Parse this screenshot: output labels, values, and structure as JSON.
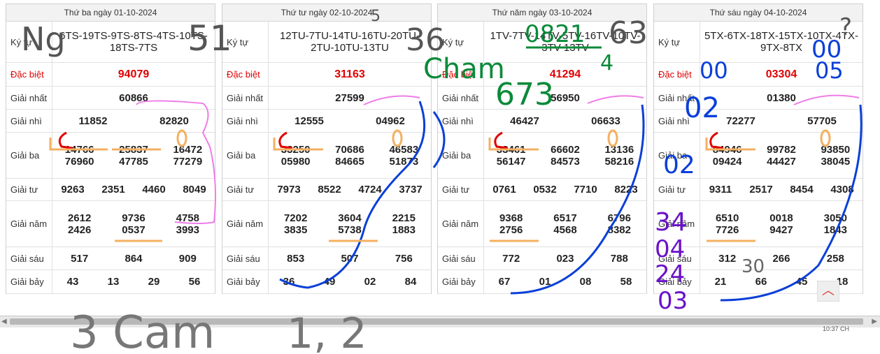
{
  "panels": [
    {
      "title": "Thứ ba ngày 01-10-2024",
      "kytu_label": "Ký tự",
      "kytu": "6TS-19TS-9TS-8TS-4TS-10TS-18TS-7TS",
      "rows": [
        {
          "label": "Đặc biệt",
          "values": [
            "94079"
          ]
        },
        {
          "label": "Giải nhất",
          "values": [
            "60866"
          ]
        },
        {
          "label": "Giải nhì",
          "values": [
            "11852",
            "82820"
          ]
        },
        {
          "label": "Giải ba",
          "values": [
            "14766",
            "25837",
            "16472",
            "76960",
            "47785",
            "77279"
          ]
        },
        {
          "label": "Giải tư",
          "values": [
            "9263",
            "2351",
            "4460",
            "8049"
          ]
        },
        {
          "label": "Giải năm",
          "values": [
            "2612",
            "9736",
            "4758",
            "2426",
            "0537",
            "3993"
          ]
        },
        {
          "label": "Giải sáu",
          "values": [
            "517",
            "864",
            "909"
          ]
        },
        {
          "label": "Giải bảy",
          "values": [
            "43",
            "13",
            "29",
            "56"
          ]
        }
      ]
    },
    {
      "title": "Thứ tư ngày 02-10-2024",
      "kytu_label": "Ký tự",
      "kytu": "12TU-7TU-14TU-16TU-20TU-2TU-10TU-13TU",
      "rows": [
        {
          "label": "Đặc biệt",
          "values": [
            "31163"
          ]
        },
        {
          "label": "Giải nhất",
          "values": [
            "27599"
          ]
        },
        {
          "label": "Giải nhì",
          "values": [
            "12555",
            "04962"
          ]
        },
        {
          "label": "Giải ba",
          "values": [
            "33250",
            "70686",
            "46583",
            "05980",
            "84665",
            "51873"
          ]
        },
        {
          "label": "Giải tư",
          "values": [
            "7973",
            "8522",
            "4724",
            "3737"
          ]
        },
        {
          "label": "Giải năm",
          "values": [
            "7202",
            "3604",
            "2215",
            "3835",
            "5738",
            "1883"
          ]
        },
        {
          "label": "Giải sáu",
          "values": [
            "853",
            "507",
            "756"
          ]
        },
        {
          "label": "Giải bảy",
          "values": [
            "36",
            "49",
            "02",
            "84"
          ]
        }
      ]
    },
    {
      "title": "Thứ năm ngày 03-10-2024",
      "kytu_label": "Ký tự",
      "kytu": "1TV-7TV-14TV-5TV-16TV-10TV-3TV-13TV",
      "rows": [
        {
          "label": "Đặc biệt",
          "values": [
            "41294"
          ]
        },
        {
          "label": "Giải nhất",
          "values": [
            "56950"
          ]
        },
        {
          "label": "Giải nhì",
          "values": [
            "46427",
            "06633"
          ]
        },
        {
          "label": "Giải ba",
          "values": [
            "33461",
            "66602",
            "13136",
            "56147",
            "84573",
            "58216"
          ]
        },
        {
          "label": "Giải tư",
          "values": [
            "0761",
            "0532",
            "7710",
            "8223"
          ]
        },
        {
          "label": "Giải năm",
          "values": [
            "9368",
            "6517",
            "6796",
            "2756",
            "4568",
            "8382"
          ]
        },
        {
          "label": "Giải sáu",
          "values": [
            "772",
            "023",
            "788"
          ]
        },
        {
          "label": "Giải bảy",
          "values": [
            "67",
            "01",
            "08",
            "58"
          ]
        }
      ]
    },
    {
      "title": "Thứ sáu ngày 04-10-2024",
      "kytu_label": "Ký tự",
      "kytu": "5TX-6TX-18TX-15TX-10TX-4TX-9TX-8TX",
      "rows": [
        {
          "label": "Đặc biệt",
          "values": [
            "03304"
          ]
        },
        {
          "label": "Giải nhất",
          "values": [
            "01380"
          ]
        },
        {
          "label": "Giải nhì",
          "values": [
            "72277",
            "57705"
          ]
        },
        {
          "label": "Giải ba",
          "values": [
            "84946",
            "99782",
            "93850",
            "09424",
            "44427",
            "38045"
          ]
        },
        {
          "label": "Giải tư",
          "values": [
            "9311",
            "2517",
            "8454",
            "4308"
          ]
        },
        {
          "label": "Giải năm",
          "values": [
            "6510",
            "0018",
            "3050",
            "7726",
            "9427",
            "1843"
          ]
        },
        {
          "label": "Giải sáu",
          "values": [
            "312",
            "266",
            "258"
          ]
        },
        {
          "label": "Giải bảy",
          "values": [
            "21",
            "66",
            "45",
            "18"
          ]
        }
      ]
    }
  ],
  "handwriting": {
    "ng": "Ng",
    "n51": "51",
    "n36": "36",
    "cham": "Cham",
    "n0821": "0821",
    "n63": "63",
    "n4": "4",
    "n673": "673",
    "n5": "5",
    "q": "?",
    "oo": "00",
    "o5": "05",
    "o2": "02",
    "n02b": "02",
    "n34": "34",
    "n04": "04",
    "n24": "24",
    "n03": "03",
    "n30": "30",
    "cam": "3 Cam",
    "n12": "1, 2"
  },
  "colors": {
    "red": "#e00000",
    "blue": "#0a3fd8",
    "pink": "#f07ce8",
    "orange": "#f4b060",
    "green": "#0b8a3a",
    "purple": "#6a12c9",
    "gray": "#8a8a8a"
  },
  "ui": {
    "scroll_up_icon": "chevron-up-icon",
    "clock": "10:37 CH"
  }
}
